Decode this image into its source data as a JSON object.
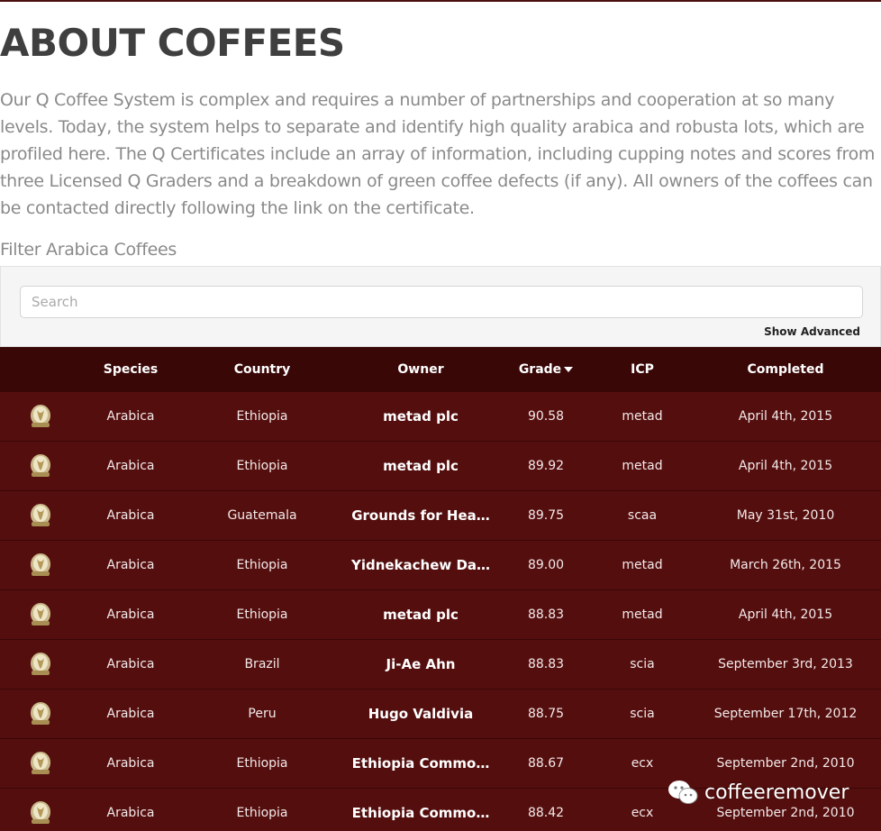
{
  "page": {
    "title": "ABOUT COFFEES",
    "intro": "Our Q Coffee System is complex and requires a number of partnerships and cooperation at so many levels. Today, the system helps to separate and identify high quality arabica and robusta lots, which are profiled here. The Q Certificates include an array of information, including cupping notes and scores from three Licensed Q Graders and a breakdown of green coffee defects (if any). All owners of the coffees can be contacted directly following the link on the certificate."
  },
  "filter": {
    "label": "Filter Arabica Coffees",
    "search_placeholder": "Search",
    "show_advanced": "Show Advanced"
  },
  "table": {
    "headers": {
      "species": "Species",
      "country": "Country",
      "owner": "Owner",
      "grade": "Grade",
      "icp": "ICP",
      "completed": "Completed"
    },
    "rows": [
      {
        "icon": "arabica-badge-icon",
        "species": "Arabica",
        "country": "Ethiopia",
        "owner": "metad plc",
        "grade": "90.58",
        "icp": "metad",
        "completed": "April 4th, 2015"
      },
      {
        "icon": "arabica-badge-icon",
        "species": "Arabica",
        "country": "Ethiopia",
        "owner": "metad plc",
        "grade": "89.92",
        "icp": "metad",
        "completed": "April 4th, 2015"
      },
      {
        "icon": "arabica-badge-icon",
        "species": "Arabica",
        "country": "Guatemala",
        "owner": "Grounds for Hea…",
        "grade": "89.75",
        "icp": "scaa",
        "completed": "May 31st, 2010"
      },
      {
        "icon": "arabica-badge-icon",
        "species": "Arabica",
        "country": "Ethiopia",
        "owner": "Yidnekachew Da…",
        "grade": "89.00",
        "icp": "metad",
        "completed": "March 26th, 2015"
      },
      {
        "icon": "arabica-badge-icon",
        "species": "Arabica",
        "country": "Ethiopia",
        "owner": "metad plc",
        "grade": "88.83",
        "icp": "metad",
        "completed": "April 4th, 2015"
      },
      {
        "icon": "arabica-badge-icon",
        "species": "Arabica",
        "country": "Brazil",
        "owner": "Ji-Ae Ahn",
        "grade": "88.83",
        "icp": "scia",
        "completed": "September 3rd, 2013"
      },
      {
        "icon": "arabica-badge-icon",
        "species": "Arabica",
        "country": "Peru",
        "owner": "Hugo Valdivia",
        "grade": "88.75",
        "icp": "scia",
        "completed": "September 17th, 2012"
      },
      {
        "icon": "arabica-badge-icon",
        "species": "Arabica",
        "country": "Ethiopia",
        "owner": "Ethiopia Commo…",
        "grade": "88.67",
        "icp": "ecx",
        "completed": "September 2nd, 2010"
      },
      {
        "icon": "arabica-badge-icon",
        "species": "Arabica",
        "country": "Ethiopia",
        "owner": "Ethiopia Commo…",
        "grade": "88.42",
        "icp": "ecx",
        "completed": "September 2nd, 2010"
      }
    ]
  },
  "watermark": {
    "text": "coffeeremover"
  },
  "colors": {
    "header_bg": "#3a0707",
    "row_bg": "#550e0e",
    "title_text": "#3f3f3f",
    "body_text": "#8a8a8a"
  }
}
